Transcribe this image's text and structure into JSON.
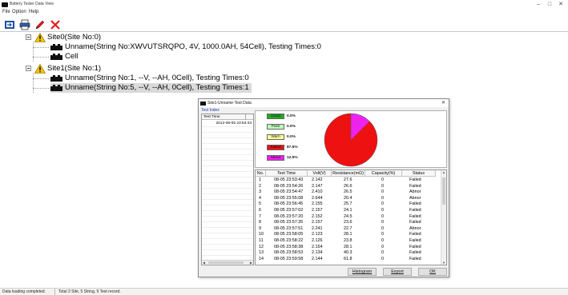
{
  "window": {
    "title": "Battery Tester Data View",
    "controls": {
      "minimize": "–",
      "maximize": "□",
      "close": "✕"
    }
  },
  "menu": [
    "File",
    "Option",
    "Help"
  ],
  "toolbar": {
    "buttons": [
      "import-icon",
      "print-icon",
      "pen-icon",
      "delete-icon"
    ]
  },
  "tree": {
    "site0": {
      "label": "Site0(Site No:0)"
    },
    "site0_string": {
      "label": "Unname(String No:XWVUTSRQPO, 4V, 1000.0AH, 54Cell), Testing Times:0"
    },
    "site0_cell": {
      "label": "Cell"
    },
    "site1": {
      "label": "Site1(Site No:1)"
    },
    "site1_string1": {
      "label": "Unname(String No:1, --V, --AH, 0Cell), Testing Times:0"
    },
    "site1_string5": {
      "label": "Unname(String No:5, --V, --AH, 0Cell), Testing Times:1"
    }
  },
  "status": {
    "left": "Data loading completed.",
    "right": "Total 2 Site, 5 String, 9 Test record."
  },
  "dialog": {
    "title": "Site1-Unname-Test Data",
    "close": "✕",
    "tab": "Test Index",
    "test_list": {
      "header": "Test Time",
      "rows": [
        "2012-08-05 23:53:43"
      ]
    },
    "summary": [
      {
        "label": "Good",
        "pct": "0.0%",
        "color": "#22aa22"
      },
      {
        "label": "Pass",
        "pct": "0.0%",
        "color": "#bfffbf"
      },
      {
        "label": "Warn",
        "pct": "0.0%",
        "color": "#ffff99"
      },
      {
        "label": "Failed",
        "pct": "87.5%",
        "color": "#ee1111"
      },
      {
        "label": "Abnor",
        "pct": "12.5%",
        "color": "#ee22ee"
      }
    ],
    "pie": {
      "failed_fraction": 0.875,
      "abnor_fraction": 0.125,
      "failed_color": "#ee1111",
      "abnor_color": "#ee22ee"
    },
    "table": {
      "columns": [
        "No.",
        "Test Time",
        "Volt(V)",
        "Resistance(mΩ)",
        "Capacity(%)",
        "Status"
      ],
      "rows": [
        [
          "1",
          "08-05 23:53:43",
          "2.142",
          "27.6",
          "0",
          "Failed"
        ],
        [
          "2",
          "08-05 23:54:26",
          "2.147",
          "26.6",
          "0",
          "Failed"
        ],
        [
          "3",
          "08-05 23:54:47",
          "2.410",
          "26.5",
          "0",
          "Abnor"
        ],
        [
          "4",
          "08-05 23:55:08",
          "2.644",
          "20.4",
          "0",
          "Abnor"
        ],
        [
          "5",
          "08-05 23:56:45",
          "2.155",
          "25.7",
          "0",
          "Failed"
        ],
        [
          "6",
          "08-05 23:57:02",
          "2.157",
          "24.1",
          "0",
          "Failed"
        ],
        [
          "7",
          "08-05 23:57:20",
          "2.152",
          "24.5",
          "0",
          "Failed"
        ],
        [
          "8",
          "08-05 23:57:35",
          "2.157",
          "23.6",
          "0",
          "Failed"
        ],
        [
          "9",
          "08-05 23:57:51",
          "2.241",
          "22.7",
          "0",
          "Abnor"
        ],
        [
          "10",
          "08-05 23:58:05",
          "2.123",
          "28.1",
          "0",
          "Failed"
        ],
        [
          "11",
          "08-05 23:58:22",
          "2.126",
          "23.8",
          "0",
          "Failed"
        ],
        [
          "12",
          "08-05 23:58:38",
          "2.154",
          "28.1",
          "0",
          "Failed"
        ],
        [
          "13",
          "08-05 23:58:53",
          "2.134",
          "40.3",
          "0",
          "Failed"
        ],
        [
          "14",
          "08-05 23:59:58",
          "2.144",
          "61.8",
          "0",
          "Failed"
        ]
      ]
    },
    "buttons": {
      "histogram": "Histogram",
      "export": "Export",
      "ok": "OK"
    }
  }
}
